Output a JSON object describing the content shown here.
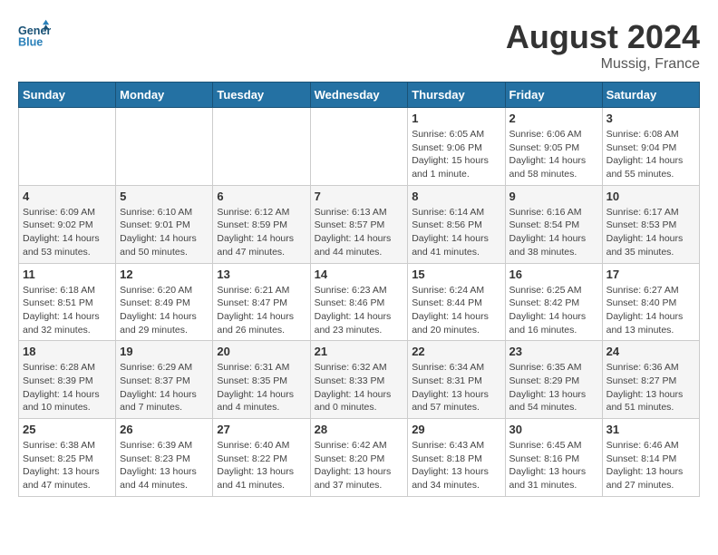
{
  "header": {
    "logo_line1": "General",
    "logo_line2": "Blue",
    "month_title": "August 2024",
    "location": "Mussig, France"
  },
  "days_of_week": [
    "Sunday",
    "Monday",
    "Tuesday",
    "Wednesday",
    "Thursday",
    "Friday",
    "Saturday"
  ],
  "weeks": [
    {
      "days": [
        {
          "num": "",
          "info": ""
        },
        {
          "num": "",
          "info": ""
        },
        {
          "num": "",
          "info": ""
        },
        {
          "num": "",
          "info": ""
        },
        {
          "num": "1",
          "info": "Sunrise: 6:05 AM\nSunset: 9:06 PM\nDaylight: 15 hours and 1 minute."
        },
        {
          "num": "2",
          "info": "Sunrise: 6:06 AM\nSunset: 9:05 PM\nDaylight: 14 hours and 58 minutes."
        },
        {
          "num": "3",
          "info": "Sunrise: 6:08 AM\nSunset: 9:04 PM\nDaylight: 14 hours and 55 minutes."
        }
      ]
    },
    {
      "days": [
        {
          "num": "4",
          "info": "Sunrise: 6:09 AM\nSunset: 9:02 PM\nDaylight: 14 hours and 53 minutes."
        },
        {
          "num": "5",
          "info": "Sunrise: 6:10 AM\nSunset: 9:01 PM\nDaylight: 14 hours and 50 minutes."
        },
        {
          "num": "6",
          "info": "Sunrise: 6:12 AM\nSunset: 8:59 PM\nDaylight: 14 hours and 47 minutes."
        },
        {
          "num": "7",
          "info": "Sunrise: 6:13 AM\nSunset: 8:57 PM\nDaylight: 14 hours and 44 minutes."
        },
        {
          "num": "8",
          "info": "Sunrise: 6:14 AM\nSunset: 8:56 PM\nDaylight: 14 hours and 41 minutes."
        },
        {
          "num": "9",
          "info": "Sunrise: 6:16 AM\nSunset: 8:54 PM\nDaylight: 14 hours and 38 minutes."
        },
        {
          "num": "10",
          "info": "Sunrise: 6:17 AM\nSunset: 8:53 PM\nDaylight: 14 hours and 35 minutes."
        }
      ]
    },
    {
      "days": [
        {
          "num": "11",
          "info": "Sunrise: 6:18 AM\nSunset: 8:51 PM\nDaylight: 14 hours and 32 minutes."
        },
        {
          "num": "12",
          "info": "Sunrise: 6:20 AM\nSunset: 8:49 PM\nDaylight: 14 hours and 29 minutes."
        },
        {
          "num": "13",
          "info": "Sunrise: 6:21 AM\nSunset: 8:47 PM\nDaylight: 14 hours and 26 minutes."
        },
        {
          "num": "14",
          "info": "Sunrise: 6:23 AM\nSunset: 8:46 PM\nDaylight: 14 hours and 23 minutes."
        },
        {
          "num": "15",
          "info": "Sunrise: 6:24 AM\nSunset: 8:44 PM\nDaylight: 14 hours and 20 minutes."
        },
        {
          "num": "16",
          "info": "Sunrise: 6:25 AM\nSunset: 8:42 PM\nDaylight: 14 hours and 16 minutes."
        },
        {
          "num": "17",
          "info": "Sunrise: 6:27 AM\nSunset: 8:40 PM\nDaylight: 14 hours and 13 minutes."
        }
      ]
    },
    {
      "days": [
        {
          "num": "18",
          "info": "Sunrise: 6:28 AM\nSunset: 8:39 PM\nDaylight: 14 hours and 10 minutes."
        },
        {
          "num": "19",
          "info": "Sunrise: 6:29 AM\nSunset: 8:37 PM\nDaylight: 14 hours and 7 minutes."
        },
        {
          "num": "20",
          "info": "Sunrise: 6:31 AM\nSunset: 8:35 PM\nDaylight: 14 hours and 4 minutes."
        },
        {
          "num": "21",
          "info": "Sunrise: 6:32 AM\nSunset: 8:33 PM\nDaylight: 14 hours and 0 minutes."
        },
        {
          "num": "22",
          "info": "Sunrise: 6:34 AM\nSunset: 8:31 PM\nDaylight: 13 hours and 57 minutes."
        },
        {
          "num": "23",
          "info": "Sunrise: 6:35 AM\nSunset: 8:29 PM\nDaylight: 13 hours and 54 minutes."
        },
        {
          "num": "24",
          "info": "Sunrise: 6:36 AM\nSunset: 8:27 PM\nDaylight: 13 hours and 51 minutes."
        }
      ]
    },
    {
      "days": [
        {
          "num": "25",
          "info": "Sunrise: 6:38 AM\nSunset: 8:25 PM\nDaylight: 13 hours and 47 minutes."
        },
        {
          "num": "26",
          "info": "Sunrise: 6:39 AM\nSunset: 8:23 PM\nDaylight: 13 hours and 44 minutes."
        },
        {
          "num": "27",
          "info": "Sunrise: 6:40 AM\nSunset: 8:22 PM\nDaylight: 13 hours and 41 minutes."
        },
        {
          "num": "28",
          "info": "Sunrise: 6:42 AM\nSunset: 8:20 PM\nDaylight: 13 hours and 37 minutes."
        },
        {
          "num": "29",
          "info": "Sunrise: 6:43 AM\nSunset: 8:18 PM\nDaylight: 13 hours and 34 minutes."
        },
        {
          "num": "30",
          "info": "Sunrise: 6:45 AM\nSunset: 8:16 PM\nDaylight: 13 hours and 31 minutes."
        },
        {
          "num": "31",
          "info": "Sunrise: 6:46 AM\nSunset: 8:14 PM\nDaylight: 13 hours and 27 minutes."
        }
      ]
    }
  ]
}
